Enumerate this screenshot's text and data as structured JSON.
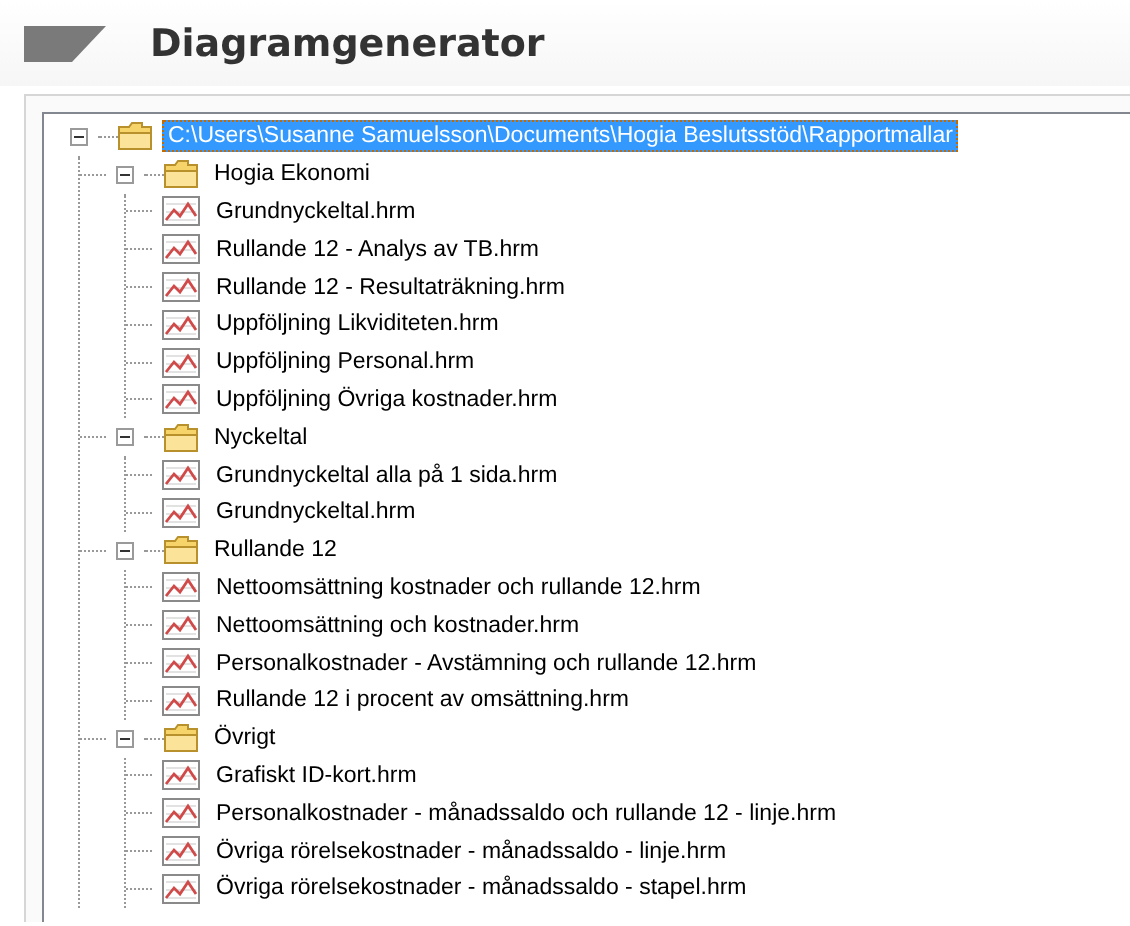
{
  "header": {
    "title": "Diagramgenerator"
  },
  "tree": [
    {
      "kind": "folder",
      "label": "C:\\Users\\Susanne Samuelsson\\Documents\\Hogia Beslutsstöd\\Rapportmallar",
      "selected": true,
      "expanded": true,
      "children": [
        {
          "kind": "folder",
          "label": "Hogia Ekonomi",
          "selected": false,
          "expanded": true,
          "children": [
            {
              "kind": "report",
              "label": "Grundnyckeltal.hrm",
              "selected": false
            },
            {
              "kind": "report",
              "label": "Rullande 12 - Analys av TB.hrm",
              "selected": false
            },
            {
              "kind": "report",
              "label": "Rullande 12 - Resultaträkning.hrm",
              "selected": false
            },
            {
              "kind": "report",
              "label": "Uppföljning Likviditeten.hrm",
              "selected": false
            },
            {
              "kind": "report",
              "label": "Uppföljning Personal.hrm",
              "selected": false
            },
            {
              "kind": "report",
              "label": "Uppföljning Övriga kostnader.hrm",
              "selected": false
            }
          ]
        },
        {
          "kind": "folder",
          "label": "Nyckeltal",
          "selected": false,
          "expanded": true,
          "children": [
            {
              "kind": "report",
              "label": "Grundnyckeltal alla på 1 sida.hrm",
              "selected": false
            },
            {
              "kind": "report",
              "label": "Grundnyckeltal.hrm",
              "selected": false
            }
          ]
        },
        {
          "kind": "folder",
          "label": "Rullande 12",
          "selected": false,
          "expanded": true,
          "children": [
            {
              "kind": "report",
              "label": "Nettoomsättning kostnader och rullande 12.hrm",
              "selected": false
            },
            {
              "kind": "report",
              "label": "Nettoomsättning och kostnader.hrm",
              "selected": false
            },
            {
              "kind": "report",
              "label": "Personalkostnader - Avstämning och rullande 12.hrm",
              "selected": false
            },
            {
              "kind": "report",
              "label": "Rullande 12 i procent av omsättning.hrm",
              "selected": false
            }
          ]
        },
        {
          "kind": "folder",
          "label": "Övrigt",
          "selected": false,
          "expanded": true,
          "children": [
            {
              "kind": "report",
              "label": "Grafiskt ID-kort.hrm",
              "selected": false
            },
            {
              "kind": "report",
              "label": "Personalkostnader - månadssaldo och rullande 12 - linje.hrm",
              "selected": false
            },
            {
              "kind": "report",
              "label": "Övriga rörelsekostnader - månadssaldo - linje.hrm",
              "selected": false
            },
            {
              "kind": "report",
              "label": "Övriga rörelsekostnader - månadssaldo - stapel.hrm",
              "selected": false
            }
          ]
        }
      ]
    }
  ]
}
